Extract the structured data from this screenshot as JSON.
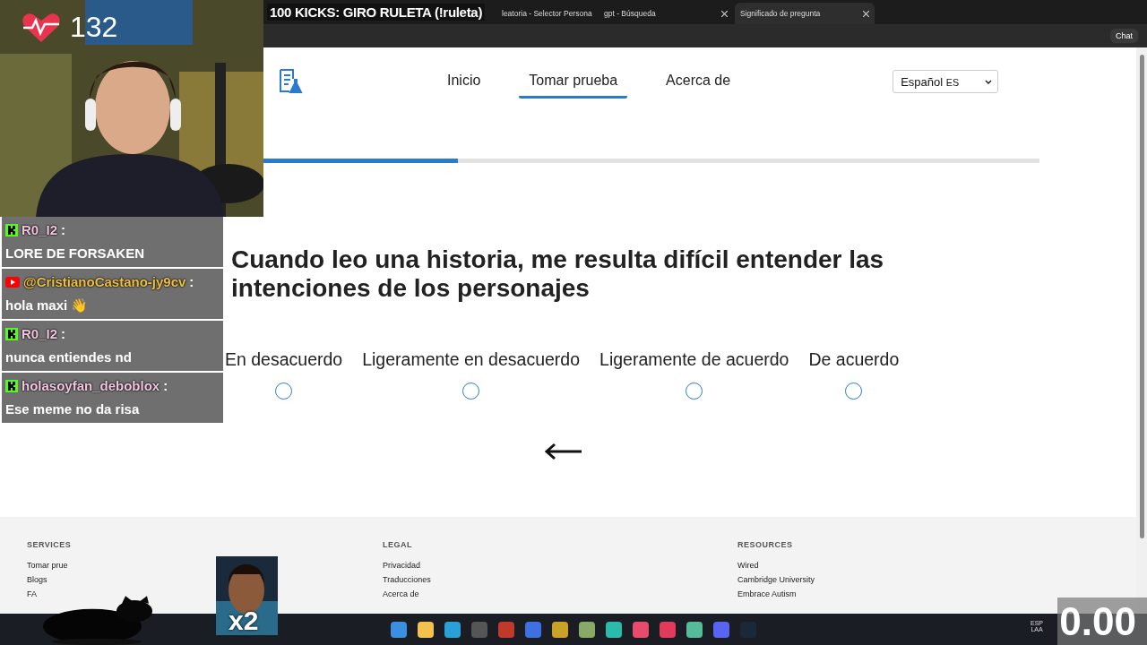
{
  "stream": {
    "title": "100 KICKS: GIRO RULETA (!ruleta)",
    "heart_rate": "132",
    "multiplier": "x2",
    "timer": "0.00"
  },
  "chat": [
    {
      "kind": "kick",
      "user": "R0_I2",
      "separator": ":",
      "text": "LORE DE FORSAKEN",
      "color": "#f0c4dc"
    },
    {
      "kind": "youtube",
      "user": "@CristianoCastano-jy9cv",
      "separator": ":",
      "text": "hola maxi 👋",
      "color": "#f0c040"
    },
    {
      "kind": "kick",
      "user": "R0_I2",
      "separator": ":",
      "text": "nunca entiendes nd",
      "color": "#f0c4dc"
    },
    {
      "kind": "kick",
      "user": "holasoyfan_deboblox",
      "separator": ":",
      "text": "Ese meme no da risa",
      "color": "#f2c6de"
    }
  ],
  "browser": {
    "tabs": [
      {
        "label": "leatoria - Selector Persona",
        "selected": false
      },
      {
        "label": "gpt - Búsqueda",
        "selected": false
      },
      {
        "label": "Significado de pregunta",
        "selected": true
      }
    ],
    "chat_button": "Chat"
  },
  "nav": {
    "items": [
      {
        "label": "Inicio",
        "selected": false
      },
      {
        "label": "Tomar prueba",
        "selected": true
      },
      {
        "label": "Acerca de",
        "selected": false
      }
    ],
    "language": "Español",
    "language_code": "ES"
  },
  "progress": {
    "level": 0.25
  },
  "question": "Cuando leo una historia, me resulta difícil entender las intenciones de los personajes",
  "options": [
    {
      "label": "En desacuerdo",
      "selected": false
    },
    {
      "label": "Ligeramente en desacuerdo",
      "selected": false
    },
    {
      "label": "Ligeramente de acuerdo",
      "selected": false
    },
    {
      "label": "De acuerdo",
      "selected": false
    }
  ],
  "footer": [
    {
      "heading": "SERVICES",
      "links": [
        "Tomar prue",
        "Blogs",
        "FA"
      ]
    },
    {
      "heading": "LEGAL",
      "links": [
        "Privacidad",
        "Traducciones",
        "Acerca de"
      ]
    },
    {
      "heading": "RESOURCES",
      "links": [
        "Wired",
        "Cambridge University",
        "Embrace Autism"
      ]
    }
  ],
  "taskbar": {
    "language": "ESP",
    "region": "LAA"
  }
}
